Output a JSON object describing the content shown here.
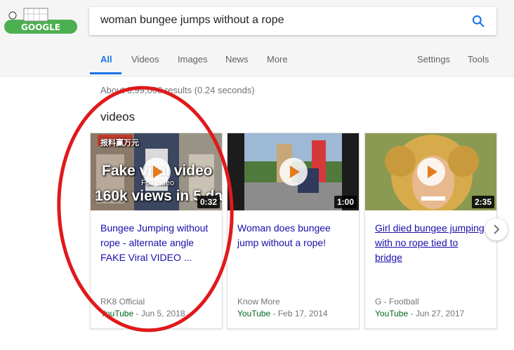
{
  "search": {
    "query": "woman bungee jumps without a rope"
  },
  "tabs": [
    "All",
    "Videos",
    "Images",
    "News",
    "More"
  ],
  "tools": {
    "settings": "Settings",
    "tools": "Tools"
  },
  "results_stats": "About 6,99,000 results (0.24 seconds)",
  "section_heading": "videos",
  "logo_text": "GOOGLE",
  "videos": [
    {
      "title": "Bungee Jumping without rope - alternate angle FAKE Viral VIDEO ...",
      "channel": "RK8 Official",
      "source": "YouTube",
      "date": " - Jun 5, 2018",
      "duration": "0:32",
      "overlay_line1": "Fake viral video",
      "overlay_line2": "160k views in 5 day",
      "overlay_small": "Full video",
      "overlay_top": "报料赢万元"
    },
    {
      "title": "Woman does bungee jump without a rope!",
      "channel": "Know More",
      "source": "YouTube",
      "date": " - Feb 17, 2014",
      "duration": "1:00"
    },
    {
      "title": "Girl died bungee jumping with no rope tied to bridge",
      "channel": "G - Football",
      "source": "YouTube",
      "date": " - Jun 27, 2017",
      "duration": "2:35"
    }
  ],
  "colors": {
    "accent": "#1a73e8",
    "link": "#1a0dab",
    "source_green": "#006621",
    "annotation_red": "#e0191b"
  }
}
